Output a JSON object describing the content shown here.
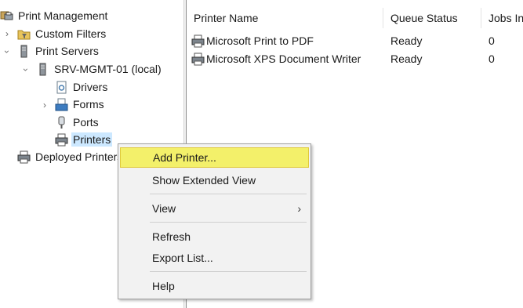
{
  "tree": {
    "root": "Print Management",
    "custom_filters": "Custom Filters",
    "print_servers": "Print Servers",
    "server": "SRV-MGMT-01 (local)",
    "drivers": "Drivers",
    "forms": "Forms",
    "ports": "Ports",
    "printers": "Printers",
    "deployed": "Deployed Printers"
  },
  "list": {
    "columns": [
      "Printer Name",
      "Queue Status",
      "Jobs In"
    ],
    "rows": [
      {
        "name": "Microsoft Print to PDF",
        "status": "Ready",
        "jobs": "0"
      },
      {
        "name": "Microsoft XPS Document Writer",
        "status": "Ready",
        "jobs": "0"
      }
    ]
  },
  "context_menu": {
    "add_printer": "Add Printer...",
    "show_extended": "Show Extended View",
    "view": "View",
    "refresh": "Refresh",
    "export": "Export List...",
    "help": "Help"
  },
  "colors": {
    "highlight": "#f3f06a",
    "selection": "#cce8ff"
  }
}
